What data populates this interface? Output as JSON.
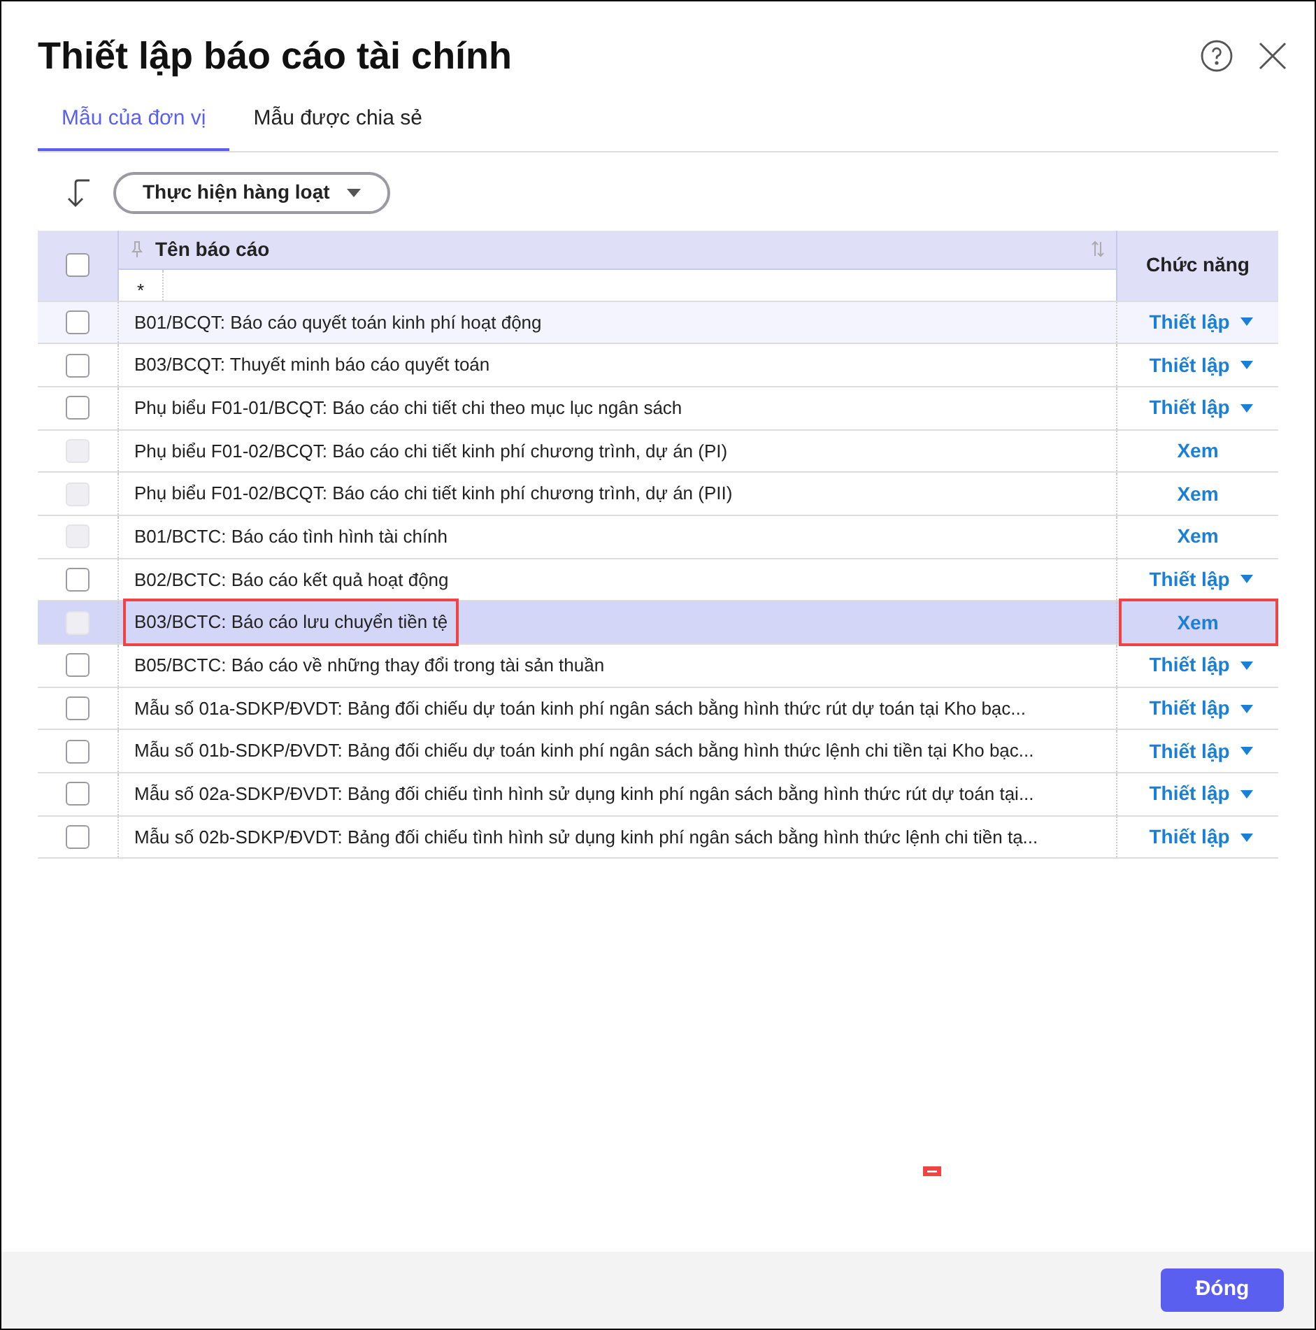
{
  "window": {
    "title": "Thiết lập báo cáo tài chính"
  },
  "tabs": [
    {
      "label": "Mẫu của đơn vị",
      "selected": true
    },
    {
      "label": "Mẫu được chia sẻ",
      "selected": false
    }
  ],
  "toolbar": {
    "bulk_button": "Thực hiện hàng loạt"
  },
  "table": {
    "columns": [
      "Tên báo cáo",
      "Chức năng"
    ],
    "filter": "*",
    "header_checked": false,
    "rows": [
      {
        "name": "B01/BCQT: Báo cáo quyết toán kinh phí hoạt động",
        "action": "Thiết lập",
        "kind": "menu",
        "checkbox_disabled": false,
        "selected": false,
        "hovered": true,
        "highlighted": false
      },
      {
        "name": "B03/BCQT: Thuyết minh báo cáo quyết toán",
        "action": "Thiết lập",
        "kind": "menu",
        "checkbox_disabled": false,
        "selected": false,
        "hovered": false,
        "highlighted": false
      },
      {
        "name": "Phụ biểu F01-01/BCQT: Báo cáo chi tiết chi theo mục lục ngân sách",
        "action": "Thiết lập",
        "kind": "menu",
        "checkbox_disabled": false,
        "selected": false,
        "hovered": false,
        "highlighted": false
      },
      {
        "name": "Phụ biểu F01-02/BCQT: Báo cáo chi tiết kinh phí chương trình, dự án (PI)",
        "action": "Xem",
        "kind": "link",
        "checkbox_disabled": true,
        "selected": false,
        "hovered": false,
        "highlighted": false
      },
      {
        "name": "Phụ biểu F01-02/BCQT: Báo cáo chi tiết kinh phí chương trình, dự án (PII)",
        "action": "Xem",
        "kind": "link",
        "checkbox_disabled": true,
        "selected": false,
        "hovered": false,
        "highlighted": false
      },
      {
        "name": "B01/BCTC: Báo cáo tình hình tài chính",
        "action": "Xem",
        "kind": "link",
        "checkbox_disabled": true,
        "selected": false,
        "hovered": false,
        "highlighted": false
      },
      {
        "name": "B02/BCTC: Báo cáo kết quả hoạt động",
        "action": "Thiết lập",
        "kind": "menu",
        "checkbox_disabled": false,
        "selected": false,
        "hovered": false,
        "highlighted": false
      },
      {
        "name": "B03/BCTC: Báo cáo lưu chuyển tiền tệ",
        "action": "Xem",
        "kind": "link",
        "checkbox_disabled": true,
        "selected": true,
        "hovered": false,
        "highlighted": true
      },
      {
        "name": "B05/BCTC: Báo cáo về những thay đổi trong tài sản thuần",
        "action": "Thiết lập",
        "kind": "menu",
        "checkbox_disabled": false,
        "selected": false,
        "hovered": false,
        "highlighted": false
      },
      {
        "name": "Mẫu số 01a-SDKP/ĐVDT: Bảng đối chiếu dự toán kinh phí ngân sách bằng hình thức rút dự toán tại Kho bạc...",
        "action": "Thiết lập",
        "kind": "menu",
        "checkbox_disabled": false,
        "selected": false,
        "hovered": false,
        "highlighted": false
      },
      {
        "name": "Mẫu số 01b-SDKP/ĐVDT: Bảng đối chiếu dự toán kinh phí ngân sách bằng hình thức lệnh chi tiền tại Kho bạc...",
        "action": "Thiết lập",
        "kind": "menu",
        "checkbox_disabled": false,
        "selected": false,
        "hovered": false,
        "highlighted": false
      },
      {
        "name": "Mẫu số 02a-SDKP/ĐVDT: Bảng đối chiếu tình hình sử dụng kinh phí ngân sách bằng hình thức rút dự toán tại...",
        "action": "Thiết lập",
        "kind": "menu",
        "checkbox_disabled": false,
        "selected": false,
        "hovered": false,
        "highlighted": false
      },
      {
        "name": "Mẫu số 02b-SDKP/ĐVDT: Bảng đối chiếu tình hình sử dụng kinh phí ngân sách bằng hình thức lệnh chi tiền tạ...",
        "action": "Thiết lập",
        "kind": "menu",
        "checkbox_disabled": false,
        "selected": false,
        "hovered": false,
        "highlighted": false
      }
    ]
  },
  "footer": {
    "close_button": "Đóng"
  }
}
